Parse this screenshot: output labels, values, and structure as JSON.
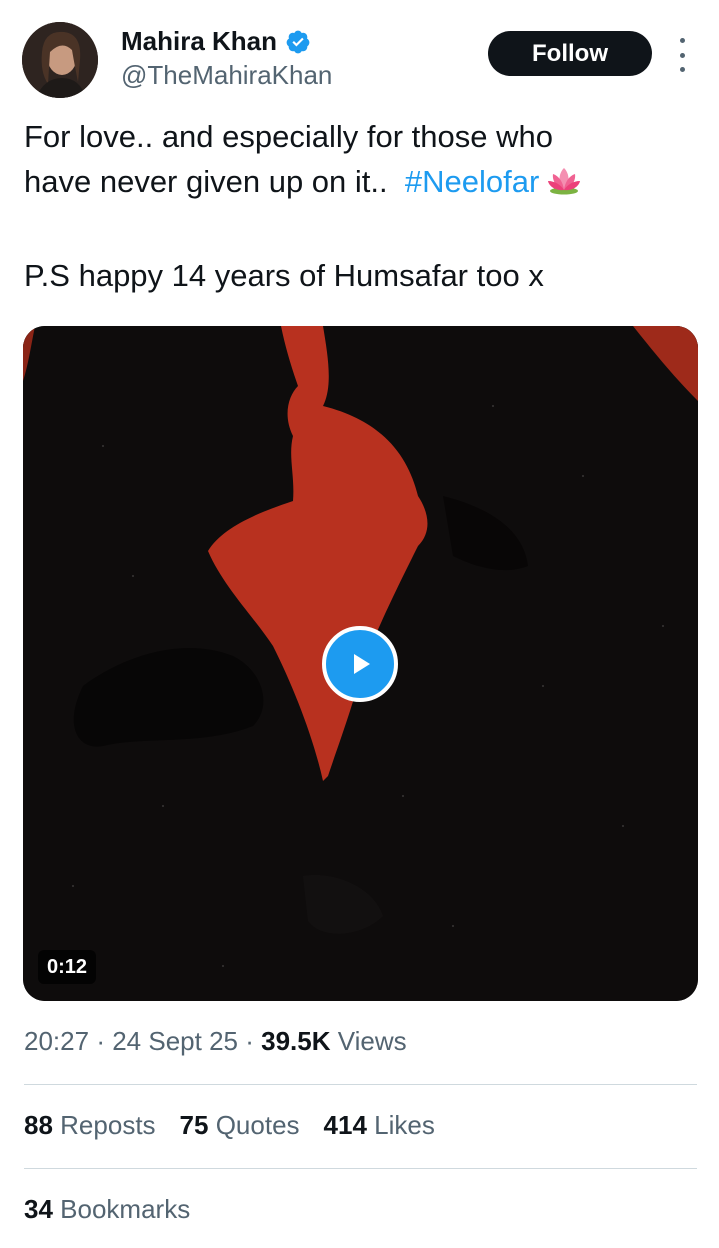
{
  "author": {
    "name": "Mahira Khan",
    "handle": "@TheMahiraKhan",
    "verified": true,
    "avatar_icon": "profile-photo"
  },
  "actions": {
    "follow_label": "Follow",
    "more_icon": "more-vertical-icon"
  },
  "tweet": {
    "line1": "For love.. and especially for those who",
    "line2_text": "have never given up on it..",
    "hashtag": "#Neelofar",
    "emoji_icon": "lotus-icon",
    "line3": "P.S happy 14 years of Humsafar too x"
  },
  "media": {
    "type": "video",
    "duration": "0:12",
    "play_icon": "play-icon"
  },
  "meta": {
    "time": "20:27",
    "sep1": "·",
    "date": "24 Sept 25",
    "sep2": "·",
    "views_count": "39.5K",
    "views_label": "Views"
  },
  "stats": {
    "reposts_count": "88",
    "reposts_label": "Reposts",
    "quotes_count": "75",
    "quotes_label": "Quotes",
    "likes_count": "414",
    "likes_label": "Likes",
    "bookmarks_count": "34",
    "bookmarks_label": "Bookmarks"
  },
  "colors": {
    "accent": "#1d9bf0",
    "text": "#0f1419",
    "muted": "#536471",
    "divider": "#cfd9de",
    "video_red": "#b8311f"
  }
}
